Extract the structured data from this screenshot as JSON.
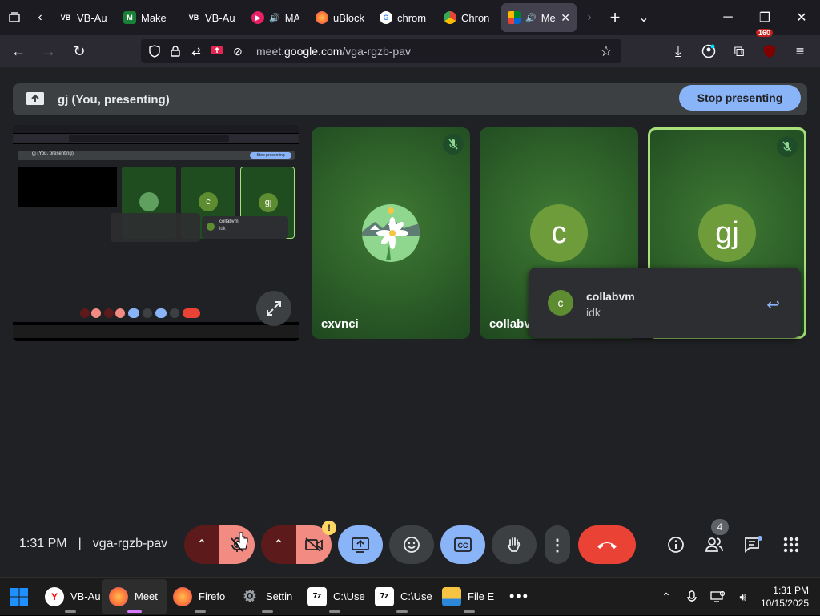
{
  "browser": {
    "tabs": [
      {
        "title": "VB-Au",
        "favicon_text": "VB",
        "favicon_color": "#1c1b22"
      },
      {
        "title": "Make",
        "favicon_text": "M",
        "favicon_color": "#1a7f37"
      },
      {
        "title": "VB-Au",
        "favicon_text": "VB",
        "favicon_color": "#1c1b22"
      },
      {
        "title": "MATU",
        "favicon_text": "▶",
        "favicon_color": "#e91e63"
      },
      {
        "title": "uBlock",
        "favicon_text": "",
        "favicon_color": "#ff7139"
      },
      {
        "title": "chrom",
        "favicon_text": "G",
        "favicon_color": "#ffffff"
      },
      {
        "title": "Chron",
        "favicon_text": "",
        "favicon_color": "#4285f4"
      },
      {
        "title": "Mee",
        "favicon_text": "",
        "favicon_color": "#00832d"
      }
    ],
    "url_prefix": "meet.",
    "url_domain": "google.com",
    "url_path": "/vga-rgzb-pav",
    "extension_badge": "160"
  },
  "meet": {
    "presenting_label": "gj (You, presenting)",
    "stop_presenting_label": "Stop presenting",
    "tiles": [
      {
        "name": "cxvnci",
        "avatar_letter": ""
      },
      {
        "name": "collabvm",
        "avatar_letter": "c"
      },
      {
        "name": "",
        "avatar_letter": "gj"
      }
    ],
    "chat": {
      "sender": "collabvm",
      "message": "idk",
      "avatar_letter": "c"
    },
    "mini_preview": {
      "presenting_label": "gj (You, presenting)",
      "stop_label": "Stop presenting",
      "chat_sender": "collabvm",
      "chat_message": "idk"
    }
  },
  "controls": {
    "time": "1:31 PM",
    "meeting_code": "vga-rgzb-pav",
    "people_count": "4",
    "camera_warning": "!"
  },
  "taskbar": {
    "items": [
      {
        "label": "VB-Au",
        "icon_color": "#ff5555"
      },
      {
        "label": "Meet",
        "icon_color": "#ff7139"
      },
      {
        "label": "Firefo",
        "icon_color": "#ff7139"
      },
      {
        "label": "Settin",
        "icon_color": "#666666"
      },
      {
        "label": "C:\\Use",
        "icon_color": "#3a3a3a"
      },
      {
        "label": "C:\\Use",
        "icon_color": "#3a3a3a"
      },
      {
        "label": "File E",
        "icon_color": "#f6c343"
      }
    ],
    "clock_time": "1:31 PM",
    "clock_date": "10/15/2025"
  },
  "colors": {
    "accent_blue": "#8ab4f8",
    "hangup_red": "#ea4335",
    "tile_green": "#2d5f28",
    "speaking_border": "#a8e07a"
  }
}
